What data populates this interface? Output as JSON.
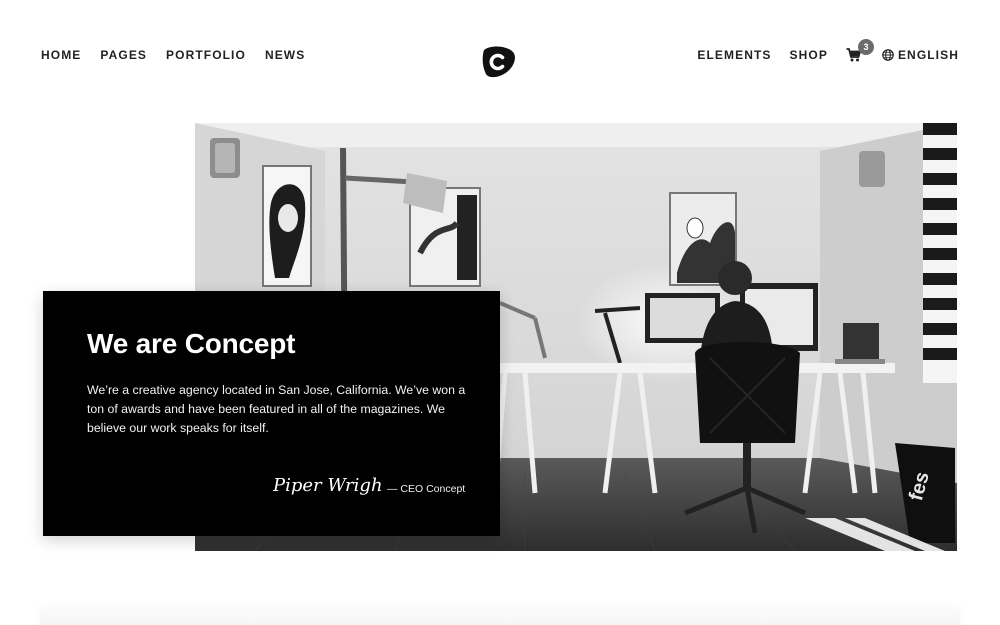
{
  "header": {
    "nav_left": [
      {
        "label": "HOME"
      },
      {
        "label": "PAGES"
      },
      {
        "label": "PORTFOLIO"
      },
      {
        "label": "NEWS"
      }
    ],
    "nav_right": {
      "elements": "ELEMENTS",
      "shop": "SHOP",
      "cart_count": "3",
      "language": "ENGLISH"
    },
    "logo_letter": "c",
    "icons": [
      "logo-icon",
      "cart-icon",
      "globe-icon"
    ]
  },
  "hero": {
    "image_alt": "Black and white photo of a home office with a person working at desk with monitors"
  },
  "intro_card": {
    "title": "We are Concept",
    "body": "We’re a creative agency located in San Jose, California. We’ve won a ton of awards and have been featured in all of the magazines. We believe our work speaks for itself.",
    "signature_name": "Piper Wright",
    "signature_role": "— CEO Concept"
  },
  "colors": {
    "background": "#ffffff",
    "text": "#222222",
    "card_bg": "#000000",
    "badge": "#6b6b6b"
  }
}
